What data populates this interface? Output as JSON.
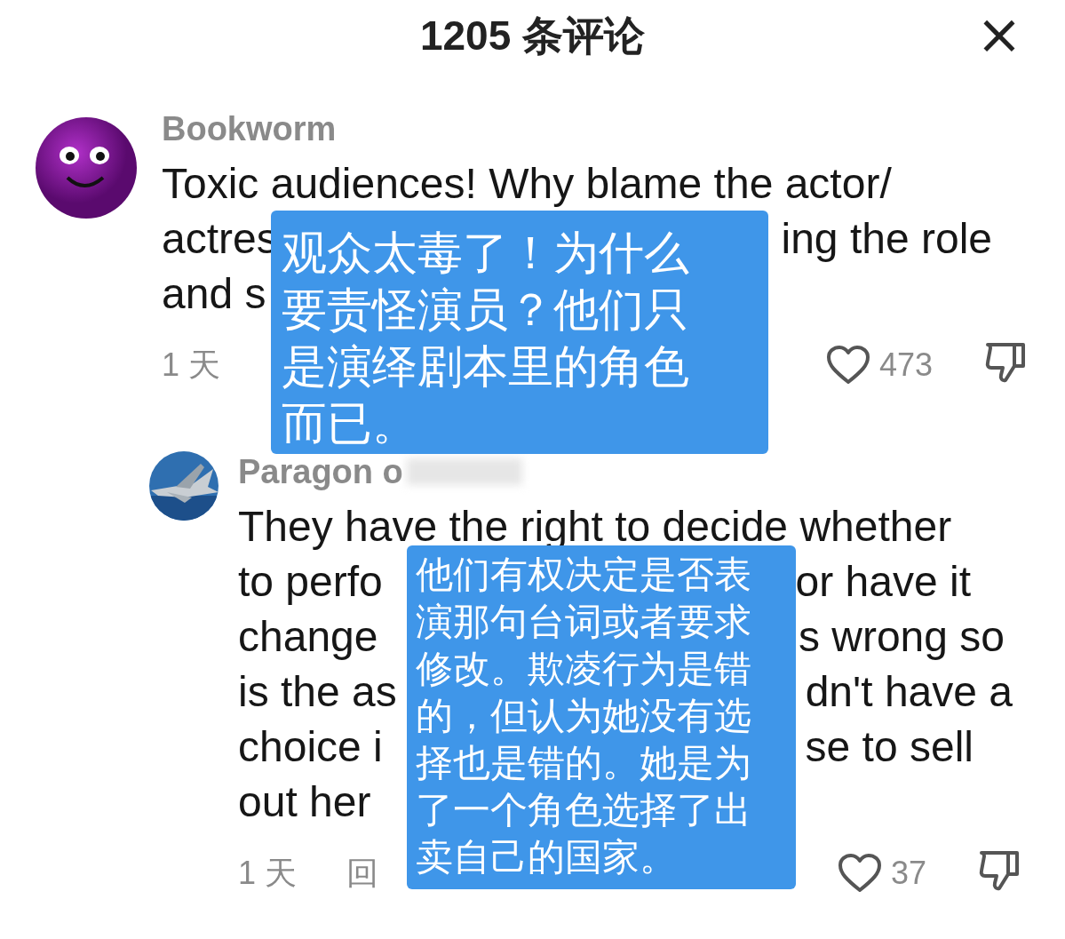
{
  "header": {
    "title": "1205 条评论",
    "close": "×"
  },
  "comments": [
    {
      "avatar": {
        "kind": "smiley"
      },
      "username": "Bookworm",
      "lines": [
        {
          "left": "Toxic audiences! Why blame the actor/"
        },
        {
          "left": "actres",
          "right": "ing the role"
        },
        {
          "left": "and s"
        }
      ],
      "time": "1 天",
      "likes": "473",
      "overlay": {
        "lines": [
          "观众太毒了！为什么",
          "要责怪演员？他们只",
          "是演绎剧本里的角色",
          "而已。"
        ]
      }
    },
    {
      "avatar": {
        "kind": "picture"
      },
      "username": "Paragon o",
      "username_redacted": true,
      "lines": [
        {
          "left": "They have the right to decide whether"
        },
        {
          "left": "to perfo",
          "right": "or have it"
        },
        {
          "left": "change",
          "right": "s wrong so"
        },
        {
          "left": "is the as",
          "right": "dn't have a"
        },
        {
          "left": "choice i",
          "right": "se to sell"
        },
        {
          "left": "out her"
        }
      ],
      "time": "1 天",
      "reply": "回",
      "likes": "37",
      "overlay": {
        "lines": [
          "他们有权决定是否表",
          "演那句台词或者要求",
          "修改。欺凌行为是错",
          "的，但认为她没有选",
          "择也是错的。她是为",
          "了一个角色选择了出",
          "卖自己的国家。"
        ]
      }
    }
  ]
}
